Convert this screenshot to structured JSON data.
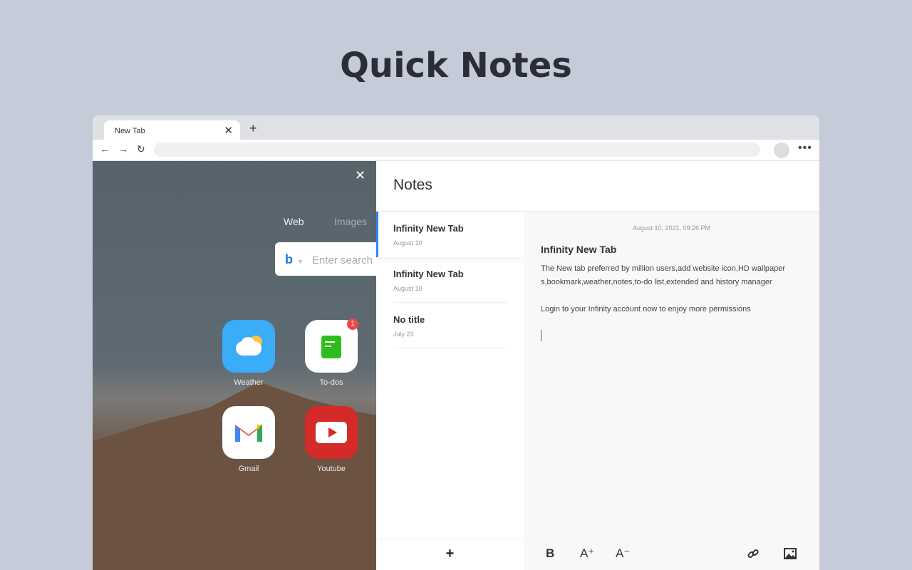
{
  "heading": "Quick Notes",
  "browser": {
    "tab_title": "New Tab",
    "close": "✕",
    "new_tab": "+",
    "back": "←",
    "forward": "→",
    "reload": "↻",
    "more": "•••"
  },
  "wallpaper": {
    "close": "✕",
    "search_tabs": [
      "Web",
      "Images"
    ],
    "search_placeholder": "Enter search",
    "engine_icon": "bing-icon",
    "apps": [
      {
        "label": "Weather",
        "icon": "weather-icon",
        "color": "#3aacf8"
      },
      {
        "label": "To-dos",
        "icon": "todo-icon",
        "badge": "1",
        "color": "#ffffff"
      },
      {
        "label": "Gmail",
        "icon": "gmail-icon",
        "color": "#ffffff"
      },
      {
        "label": "Youtube",
        "icon": "youtube-icon",
        "color": "#d42a28"
      }
    ]
  },
  "notes": {
    "title": "Notes",
    "add": "+",
    "items": [
      {
        "title": "Infinity New Tab",
        "date": "August 10"
      },
      {
        "title": "Infinity New Tab",
        "date": "August 10"
      },
      {
        "title": "No title",
        "date": "July 23"
      }
    ],
    "editor": {
      "timestamp": "August 10, 2021, 09:26 PM",
      "title": "Infinity New Tab",
      "body": "The New tab preferred by million users,add website icon,HD wallpaper s,bookmark,weather,notes,to-do list,extended and history manager\n\nLogin to your Infinity account now to enjoy more permissions",
      "tools": {
        "bold": "B",
        "increase": "A⁺",
        "decrease": "A⁻"
      }
    },
    "accent": "#2f86f0"
  }
}
